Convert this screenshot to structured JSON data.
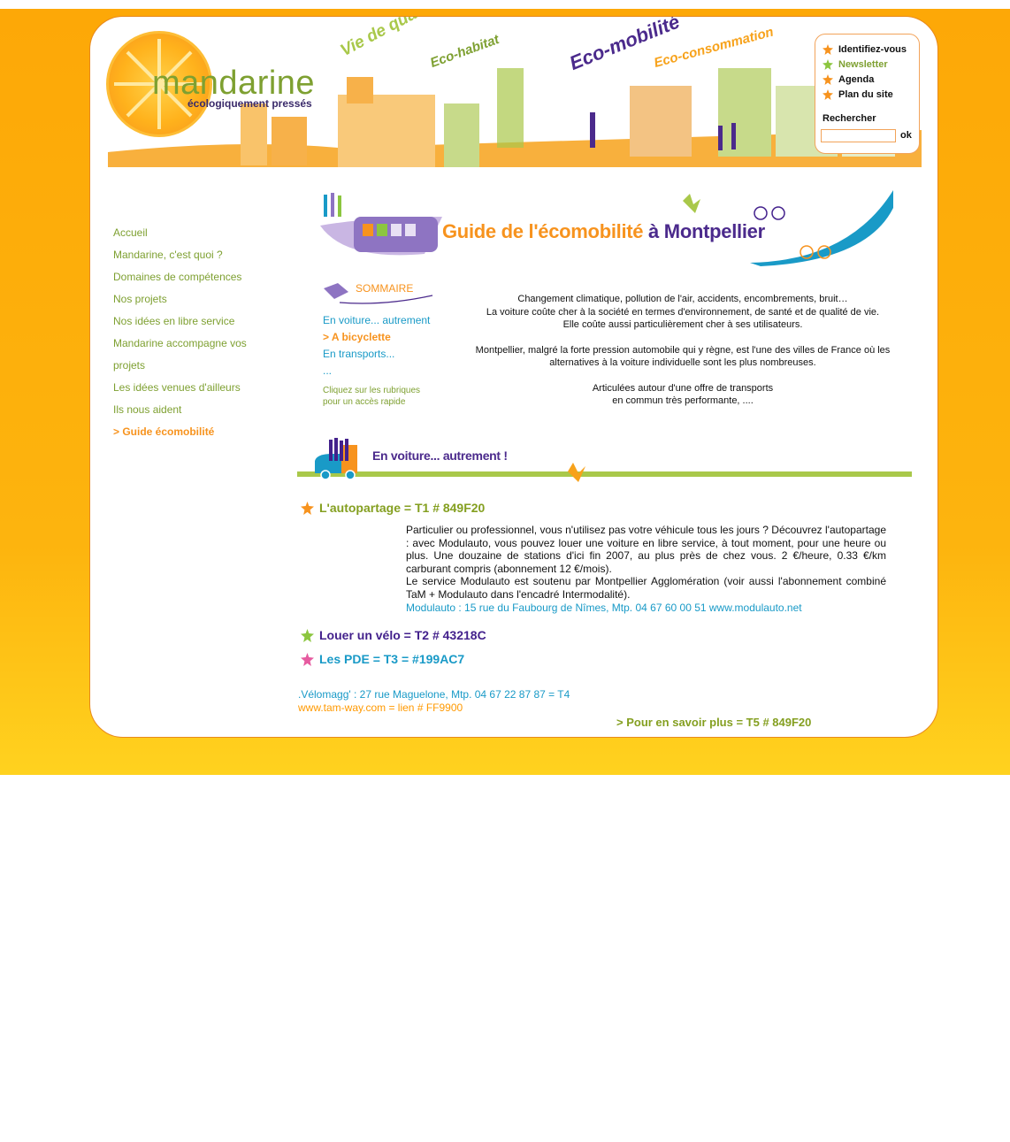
{
  "brand": {
    "name": "mandarine",
    "tagline": "écologiquement pressés"
  },
  "header": {
    "headlines": [
      "Vie de quartier",
      "Eco-habitat",
      "Eco-mobilité",
      "Eco-consommation"
    ]
  },
  "top_menu": {
    "items": [
      {
        "label": "Identifiez-vous",
        "color": "#F7931E"
      },
      {
        "label": "Newsletter",
        "color": "#8CC63F"
      },
      {
        "label": "Agenda",
        "color": "#F7931E"
      },
      {
        "label": "Plan du site",
        "color": "#F7931E"
      }
    ],
    "search_label": "Rechercher",
    "search_value": "",
    "search_button": "ok"
  },
  "left_nav": {
    "items": [
      "Accueil",
      "Mandarine, c'est quoi ?",
      "Domaines de compétences",
      "Nos projets",
      "Nos idées en libre service",
      "Mandarine accompagne vos",
      "projets",
      "Les idées venues d'ailleurs",
      "Ils nous aident",
      "> Guide écomobilité"
    ],
    "active_index": 9
  },
  "guide_banner": {
    "title_part1": "Guide de l'écomobilité",
    "title_part2": "à Montpellier"
  },
  "sommaire": {
    "label": "SOMMAIRE",
    "items": [
      "En voiture... autrement",
      "> A bicyclette",
      "En transports...",
      "..."
    ],
    "active_index": 1,
    "hint_line1": "Cliquez sur les rubriques",
    "hint_line2": "pour un accès rapide"
  },
  "intro": {
    "p1_l1": "Changement climatique, pollution de l'air, accidents, encombrements, bruit…",
    "p1_l2": "La voiture coûte cher à la société en termes d'environnement, de santé et de qualité de vie.",
    "p1_l3": "Elle coûte aussi particulièrement cher à ses utilisateurs.",
    "p2_l1": "Montpellier, malgré la forte pression automobile qui y règne, est l'une des villes de France où les",
    "p2_l2": "alternatives à la voiture individuelle sont les plus nombreuses.",
    "p3_l1": "Articulées autour d'une offre de transports",
    "p3_l2": "en commun très performante, ...."
  },
  "section_banner": {
    "title": "En voiture... autrement !"
  },
  "sections": {
    "t1": {
      "title": "L'autopartage = T1 # 849F20",
      "color": "#849F20"
    },
    "t2": {
      "title": "Louer un vélo = T2 # 43218C",
      "color": "#43218C"
    },
    "t3": {
      "title": "Les PDE = T3 = #199AC7",
      "color": "#199AC7"
    }
  },
  "body": {
    "p1": "Particulier ou professionnel, vous n'utilisez pas votre véhicule tous les jours ? Découvrez l'autopartage : avec Modulauto, vous pouvez louer une voiture en libre service, à tout moment, pour une heure ou plus. Une douzaine de stations d'ici fin 2007, au plus près de chez vous. 2 €/heure, 0.33 €/km carburant compris (abonnement 12 €/mois).",
    "p2": "Le service Modulauto est soutenu par Montpellier Agglomération (voir aussi l'abonnement combiné TaM + Modulauto dans l'encadré Intermodalité).",
    "contact": "Modulauto : 15 rue du Faubourg de Nîmes, Mtp. 04 67 60 00 51 www.modulauto.net"
  },
  "footer_links": {
    "velomagg": ".Vélomagg' : 27 rue Maguelone, Mtp. 04 67 22 87 87 = T4",
    "tamway": "www.tam-way.com = lien # FF9900",
    "more": "> Pour en savoir plus = T5 # 849F20"
  },
  "colors": {
    "orange": "#F7931E",
    "green": "#849F20",
    "purple": "#43218C",
    "blue": "#199AC7",
    "link": "#FF9900"
  }
}
